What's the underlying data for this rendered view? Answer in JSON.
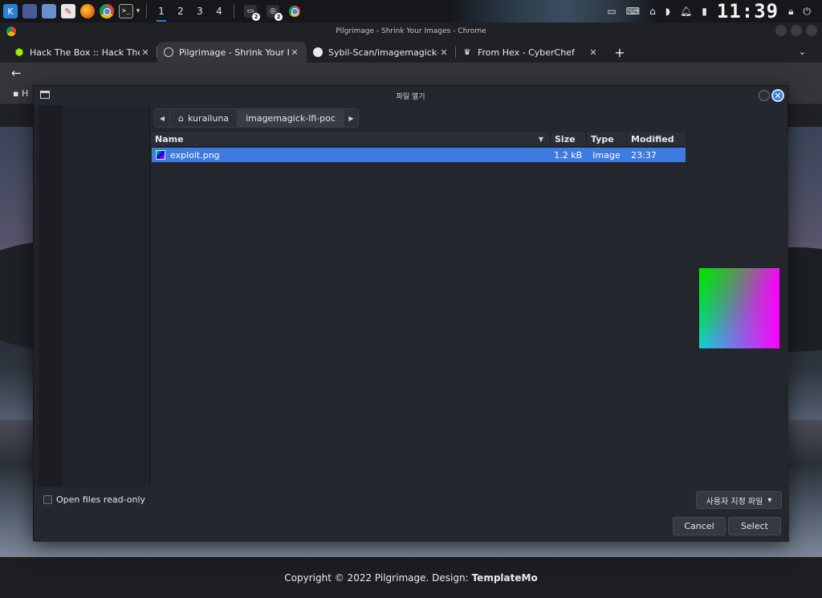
{
  "desktop": {
    "workspaces": [
      "1",
      "2",
      "3",
      "4"
    ],
    "active_workspace": "1",
    "launcher_badges": [
      "2",
      "2"
    ],
    "clock": "11:39"
  },
  "browser": {
    "window_title": "Pilgrimage - Shrink Your Images - Chrome",
    "tabs": [
      {
        "label": "Hack The Box :: Hack The B",
        "icon": "htb-cube-icon",
        "active": false
      },
      {
        "label": "Pilgrimage - Shrink Your Im",
        "icon": "globe-icon",
        "active": true
      },
      {
        "label": "Sybil-Scan/imagemagick-lf",
        "icon": "github-icon",
        "active": false
      },
      {
        "label": "From Hex - CyberChef",
        "icon": "chef-hat-icon",
        "active": false
      }
    ],
    "new_tab_label": "+",
    "bookmark_label": "H",
    "footer_text": "Copyright © 2022 Pilgrimage. Design:",
    "footer_brand": "TemplateMo"
  },
  "dialog": {
    "title": "파일 열기",
    "path": [
      "kurailuna",
      "imagemagick-lfi-poc"
    ],
    "columns": {
      "name": "Name",
      "size": "Size",
      "type": "Type",
      "modified": "Modified"
    },
    "files": [
      {
        "name": "exploit.png",
        "size": "1.2 kB",
        "type": "Image",
        "modified": "23:37"
      }
    ],
    "readonly_label": "Open files read-only",
    "filter_label": "사용자 지정 파일",
    "cancel_label": "Cancel",
    "select_label": "Select"
  },
  "colors": {
    "accent": "#3d7be0",
    "dialog_bg": "#24272e",
    "browser_bg": "#202124"
  }
}
